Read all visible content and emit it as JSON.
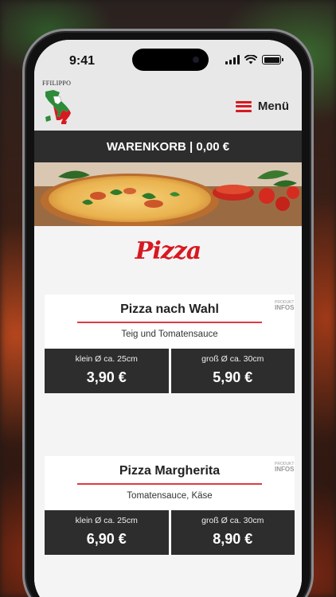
{
  "status": {
    "time": "9:41"
  },
  "header": {
    "logo_text": "FFILIPPO",
    "menu_label": "Menü"
  },
  "cart": {
    "label": "WARENKORB | 0,00 €"
  },
  "section": {
    "title": "Pizza"
  },
  "products": [
    {
      "name": "Pizza nach Wahl",
      "description": "Teig und Tomatensauce",
      "info_small": "PRODUKT",
      "info_large": "INFOS",
      "options": [
        {
          "size": "klein Ø ca. 25cm",
          "price": "3,90 €"
        },
        {
          "size": "groß Ø ca. 30cm",
          "price": "5,90 €"
        }
      ]
    },
    {
      "name": "Pizza Margherita",
      "description": "Tomatensauce, Käse",
      "info_small": "PRODUKT",
      "info_large": "INFOS",
      "options": [
        {
          "size": "klein Ø ca. 25cm",
          "price": "6,90 €"
        },
        {
          "size": "groß Ø ca. 30cm",
          "price": "8,90 €"
        }
      ]
    }
  ],
  "colors": {
    "accent": "#d71920",
    "dark": "#2d2d2d",
    "header_bg": "#e8e8e8"
  }
}
